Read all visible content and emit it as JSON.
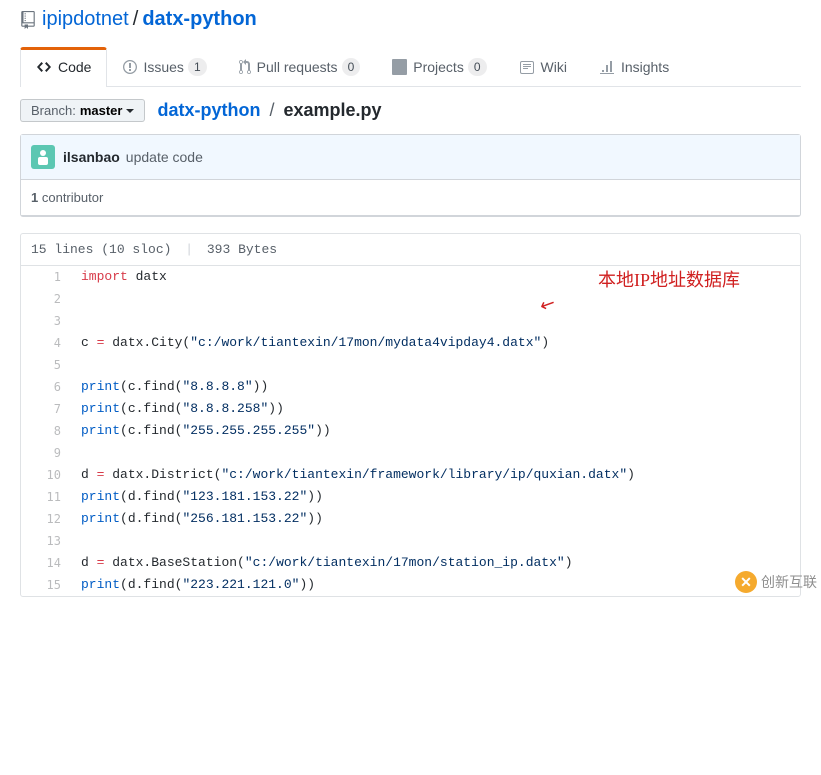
{
  "repo": {
    "owner": "ipipdotnet",
    "name": "datx-python"
  },
  "tabs": {
    "code": "Code",
    "issues": "Issues",
    "issues_count": "1",
    "prs": "Pull requests",
    "prs_count": "0",
    "projects": "Projects",
    "projects_count": "0",
    "wiki": "Wiki",
    "insights": "Insights"
  },
  "branch": {
    "label": "Branch:",
    "value": "master"
  },
  "path": {
    "root": "datx-python",
    "file": "example.py"
  },
  "commit": {
    "author": "ilsanbao",
    "message": "update code"
  },
  "contrib": {
    "count": "1",
    "label": "contributor"
  },
  "meta": {
    "lines": "15 lines (10 sloc)",
    "bytes": "393 Bytes"
  },
  "annotation": {
    "text": "本地IP地址数据库",
    "arrow": "↙"
  },
  "code": {
    "r1": {
      "kw": "import",
      "mod": " datx"
    },
    "r4": {
      "a": "c ",
      "op": "=",
      "b": " datx.City(",
      "s": "\"c:/work/tiantexin/17mon/mydata4vipday4.datx\"",
      "c": ")"
    },
    "r6": {
      "fn": "print",
      "a": "(c.find(",
      "s": "\"8.8.8.8\"",
      "b": "))"
    },
    "r7": {
      "fn": "print",
      "a": "(c.find(",
      "s": "\"8.8.8.258\"",
      "b": "))"
    },
    "r8": {
      "fn": "print",
      "a": "(c.find(",
      "s": "\"255.255.255.255\"",
      "b": "))"
    },
    "r10": {
      "a": "d ",
      "op": "=",
      "b": " datx.District(",
      "s": "\"c:/work/tiantexin/framework/library/ip/quxian.datx\"",
      "c": ")"
    },
    "r11": {
      "fn": "print",
      "a": "(d.find(",
      "s": "\"123.181.153.22\"",
      "b": "))"
    },
    "r12": {
      "fn": "print",
      "a": "(d.find(",
      "s": "\"256.181.153.22\"",
      "b": "))"
    },
    "r14": {
      "a": "d ",
      "op": "=",
      "b": " datx.BaseStation(",
      "s": "\"c:/work/tiantexin/17mon/station_ip.datx\"",
      "c": ")"
    },
    "r15": {
      "fn": "print",
      "a": "(d.find(",
      "s": "\"223.221.121.0\"",
      "b": "))"
    }
  },
  "watermark": {
    "text": "创新互联"
  }
}
